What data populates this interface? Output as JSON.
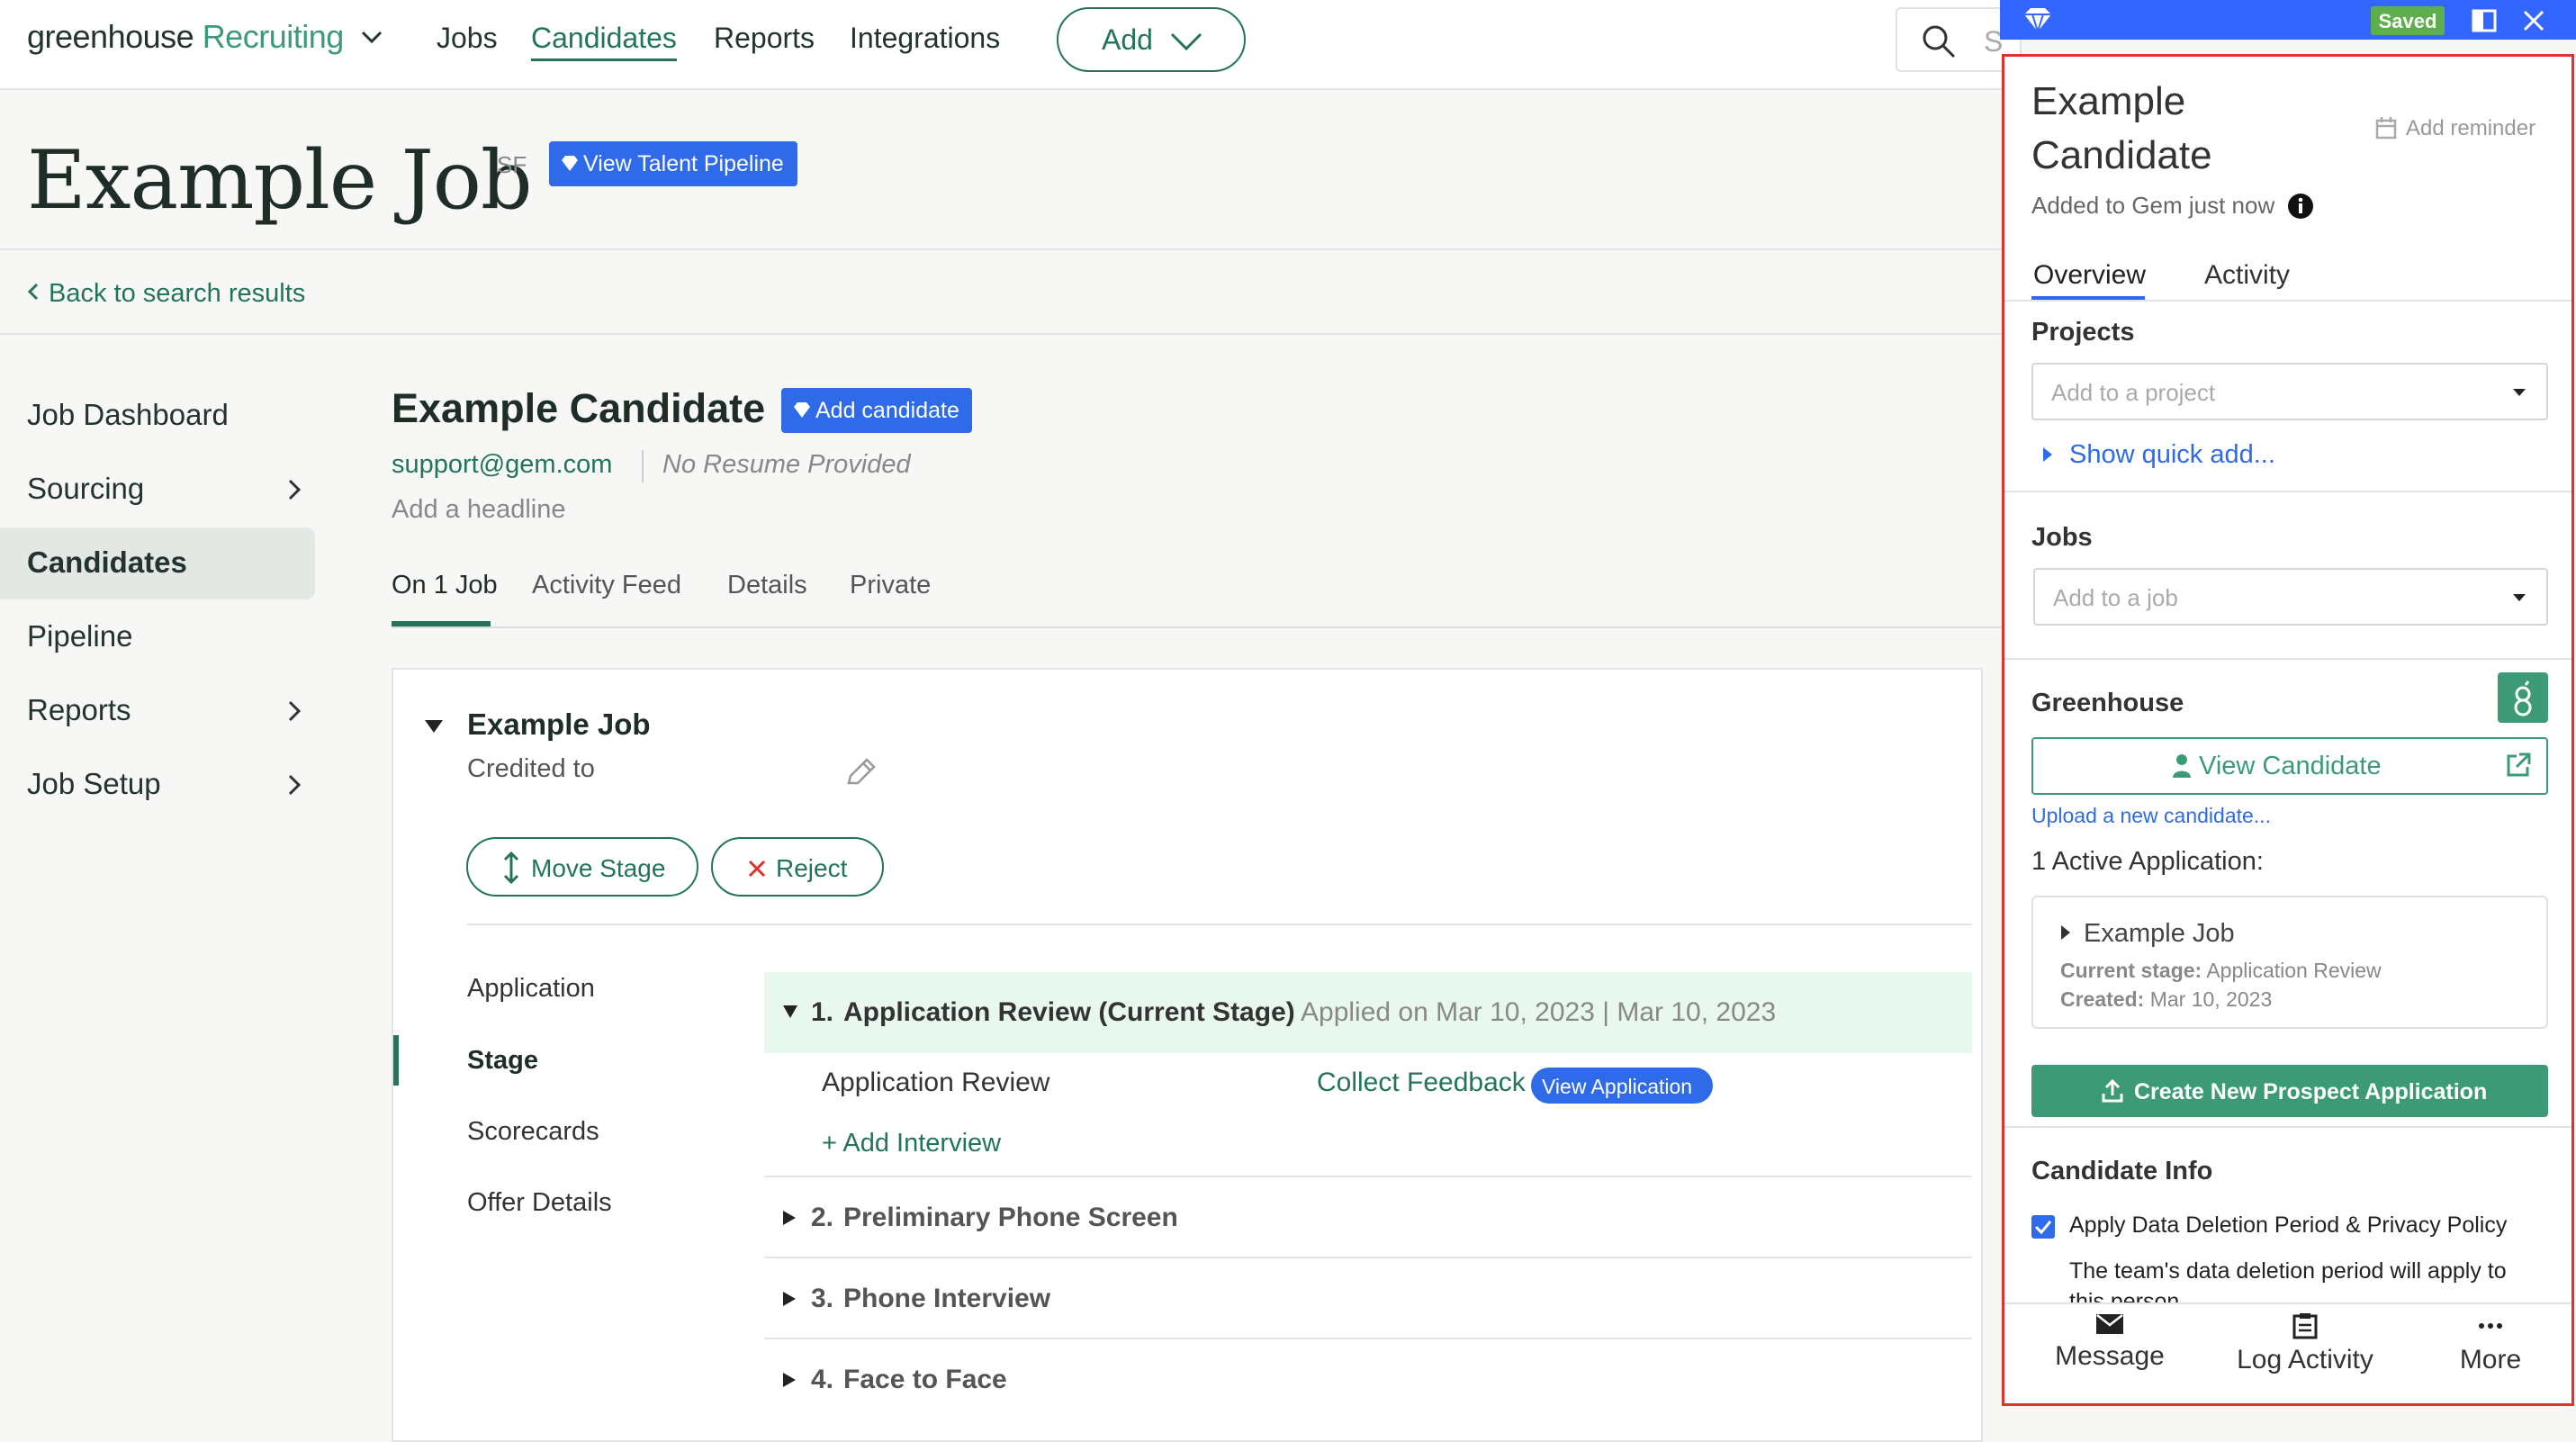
{
  "nav": {
    "logo_main": "greenhouse",
    "logo_product": "Recruiting",
    "items": [
      "Jobs",
      "Candidates",
      "Reports",
      "Integrations"
    ],
    "add_label": "Add",
    "search_placeholder": "S"
  },
  "job": {
    "title": "Example Job",
    "location": "SF",
    "view_pipeline_label": "View Talent Pipeline",
    "back_label": "Back to search results"
  },
  "sidebar": {
    "items": [
      "Job Dashboard",
      "Sourcing",
      "Candidates",
      "Pipeline",
      "Reports",
      "Job Setup"
    ]
  },
  "candidate": {
    "name": "Example Candidate",
    "add_candidate_label": "Add candidate",
    "email": "support@gem.com",
    "resume": "No Resume Provided",
    "headline_placeholder": "Add a headline",
    "tabs": [
      "On 1 Job",
      "Activity Feed",
      "Details",
      "Private"
    ]
  },
  "job_card": {
    "title": "Example Job",
    "credited": "Credited to",
    "move_stage": "Move Stage",
    "reject": "Reject",
    "stage_nav": [
      "Application",
      "Stage",
      "Scorecards",
      "Offer Details"
    ],
    "stages": [
      {
        "num": "1.",
        "name": "Application Review (Current Stage)",
        "applied": "Applied on Mar 10, 2023 | Mar 10, 2023"
      },
      {
        "num": "2.",
        "name": "Preliminary Phone Screen"
      },
      {
        "num": "3.",
        "name": "Phone Interview"
      },
      {
        "num": "4.",
        "name": "Face to Face"
      }
    ],
    "sub_stage": "Application Review",
    "collect_feedback": "Collect Feedback",
    "view_application": "View Application",
    "add_interview": "+ Add Interview"
  },
  "gem": {
    "saved": "Saved",
    "name_line1": "Example",
    "name_line2": "Candidate",
    "add_reminder": "Add reminder",
    "added_to_gem": "Added to Gem just now",
    "tabs": [
      "Overview",
      "Activity"
    ],
    "projects_heading": "Projects",
    "project_placeholder": "Add to a project",
    "show_quick_add": "Show quick add...",
    "jobs_heading": "Jobs",
    "job_placeholder": "Add to a job",
    "greenhouse_heading": "Greenhouse",
    "view_candidate": "View Candidate",
    "upload_new": "Upload a new candidate...",
    "active_apps": "1 Active Application:",
    "app_job": "Example Job",
    "current_stage_label": "Current stage:",
    "current_stage_value": "Application Review",
    "created_label": "Created:",
    "created_value": "Mar 10, 2023",
    "create_prospect": "Create New Prospect Application",
    "candidate_info_heading": "Candidate Info",
    "apply_policy": "Apply Data Deletion Period & Privacy Policy",
    "policy_note_1": "The team's data deletion period will apply to",
    "policy_note_2": "this person",
    "bottom_actions": [
      "Message",
      "Log Activity",
      "More"
    ]
  },
  "colors": {
    "greenhouse_green": "#24745a",
    "gem_blue": "#2f6ae8",
    "panel_border_red": "#e03030"
  }
}
